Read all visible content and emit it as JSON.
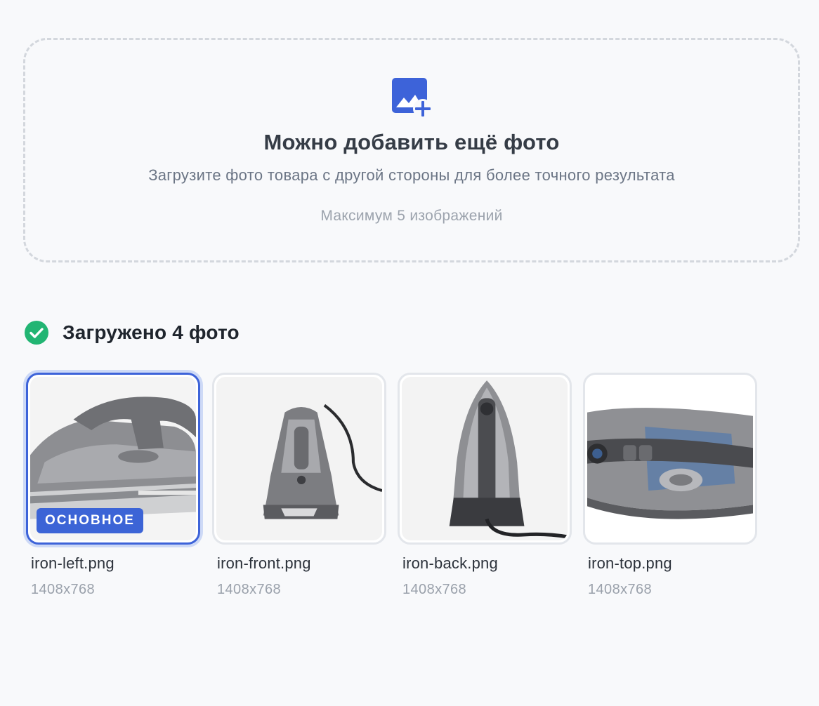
{
  "dropzone": {
    "icon": "add-photo-icon",
    "title": "Можно добавить ещё фото",
    "subtitle": "Загрузите фото товара с другой стороны для более точного результата",
    "hint": "Максимум 5 изображений",
    "accent_color": "#3d63d9"
  },
  "uploaded": {
    "icon": "check-circle-icon",
    "icon_color": "#22b573",
    "title": "Загружено 4 фото"
  },
  "thumbnails": [
    {
      "filename": "iron-left.png",
      "dimensions": "1408x768",
      "badge": "ОСНОВНОЕ",
      "primary": true,
      "subject": "steam iron, left side view"
    },
    {
      "filename": "iron-front.png",
      "dimensions": "1408x768",
      "primary": false,
      "subject": "steam iron, front view"
    },
    {
      "filename": "iron-back.png",
      "dimensions": "1408x768",
      "primary": false,
      "subject": "steam iron, back view"
    },
    {
      "filename": "iron-top.png",
      "dimensions": "1408x768",
      "primary": false,
      "subject": "steam iron, top view"
    }
  ]
}
